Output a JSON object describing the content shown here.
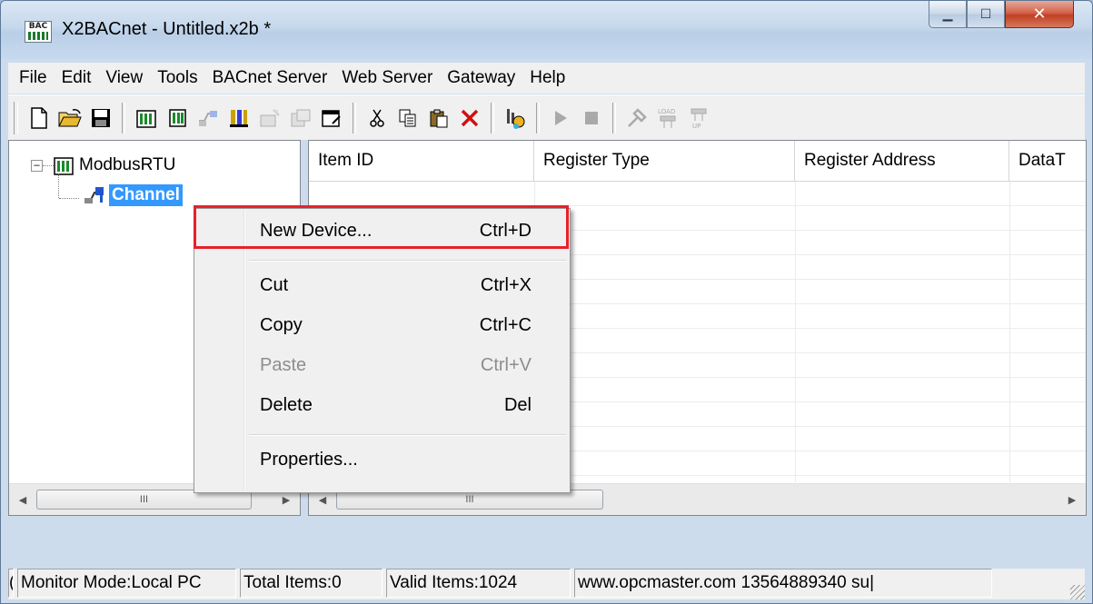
{
  "window": {
    "title": "X2BACnet - Untitled.x2b *",
    "app_icon_text": "BAC",
    "caption_buttons": [
      "minimize",
      "maximize",
      "close"
    ]
  },
  "menubar": [
    "File",
    "Edit",
    "View",
    "Tools",
    "BACnet Server",
    "Web Server",
    "Gateway",
    "Help"
  ],
  "toolbar": {
    "icons": [
      "new-icon",
      "open-icon",
      "save-icon",
      "add-channel-icon",
      "add-device-icon",
      "add-group-icon",
      "add-item-icon",
      "batch-item-icon",
      "properties-icon",
      "cut-icon",
      "copy-icon",
      "paste-icon",
      "delete-icon",
      "monitor-icon",
      "run-icon",
      "stop-icon",
      "tools-icon",
      "download-icon",
      "upload-icon"
    ],
    "load_text": "LOAD",
    "up_text": "UP"
  },
  "tree": {
    "root_label": "ModbusRTU",
    "expander": "−",
    "child_label": "Channel"
  },
  "list": {
    "columns": [
      "Item ID",
      "Register Type",
      "Register Address",
      "DataT"
    ]
  },
  "scroll": {
    "grip": "III"
  },
  "context_menu": {
    "items": [
      {
        "label": "New Device...",
        "shortcut": "Ctrl+D",
        "enabled": true
      },
      {
        "label": "Cut",
        "shortcut": "Ctrl+X",
        "enabled": true
      },
      {
        "label": "Copy",
        "shortcut": "Ctrl+C",
        "enabled": true
      },
      {
        "label": "Paste",
        "shortcut": "Ctrl+V",
        "enabled": false
      },
      {
        "label": "Delete",
        "shortcut": "Del",
        "enabled": true
      },
      {
        "label": "Properties...",
        "shortcut": "",
        "enabled": true
      }
    ]
  },
  "statusbar": {
    "first": "(",
    "mode": "Monitor Mode:Local PC",
    "total": "Total Items:0",
    "valid": "Valid Items:1024",
    "info": "www.opcmaster.com 13564889340 su|"
  },
  "colors": {
    "highlight_border": "#e8202a",
    "selection": "#3399ff",
    "close_button": "#c13f22"
  }
}
